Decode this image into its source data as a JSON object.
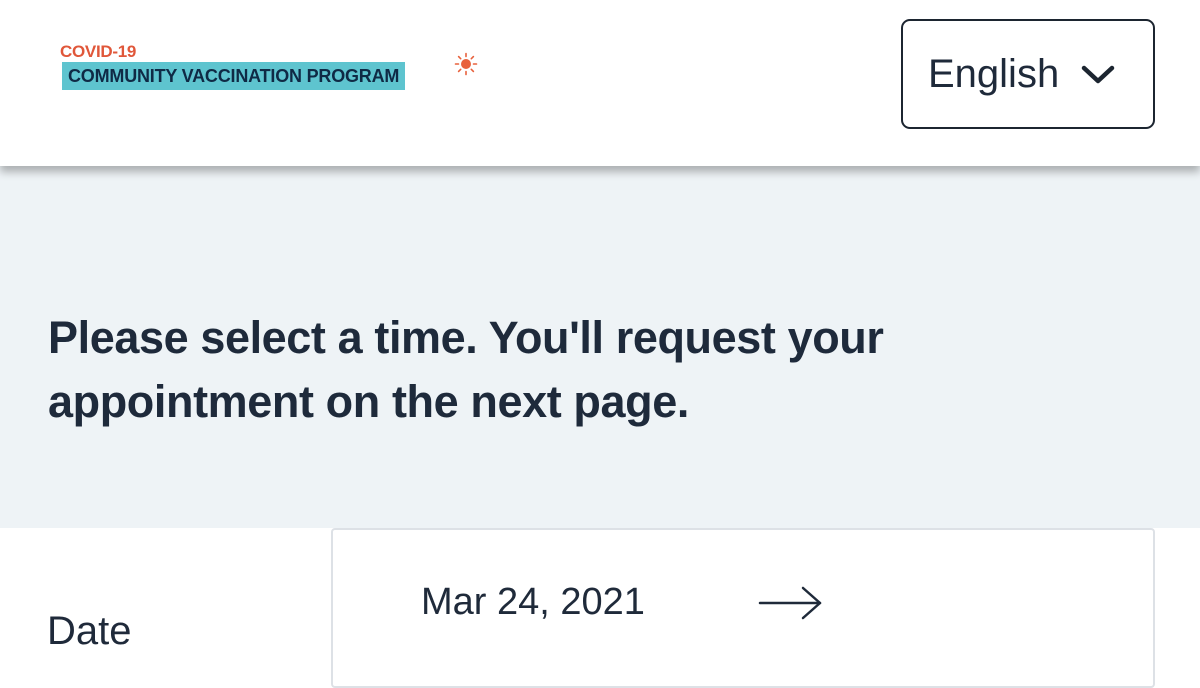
{
  "header": {
    "logo": {
      "top_text": "COVID-19",
      "band_text": "COMMUNITY VACCINATION PROGRAM",
      "icon": "sun-burst-icon",
      "colors": {
        "top_text": "#e0573a",
        "band": "#5ec4cf",
        "band_text": "#0f2a45"
      }
    },
    "language_select": {
      "value": "English",
      "icon": "chevron-down-icon"
    }
  },
  "hero": {
    "title": "Please select a time. You'll request your appointment on the next page.",
    "background": "#eef3f6"
  },
  "date_picker": {
    "label": "Date",
    "value": "Mar 24, 2021",
    "next_icon": "arrow-right-icon"
  }
}
